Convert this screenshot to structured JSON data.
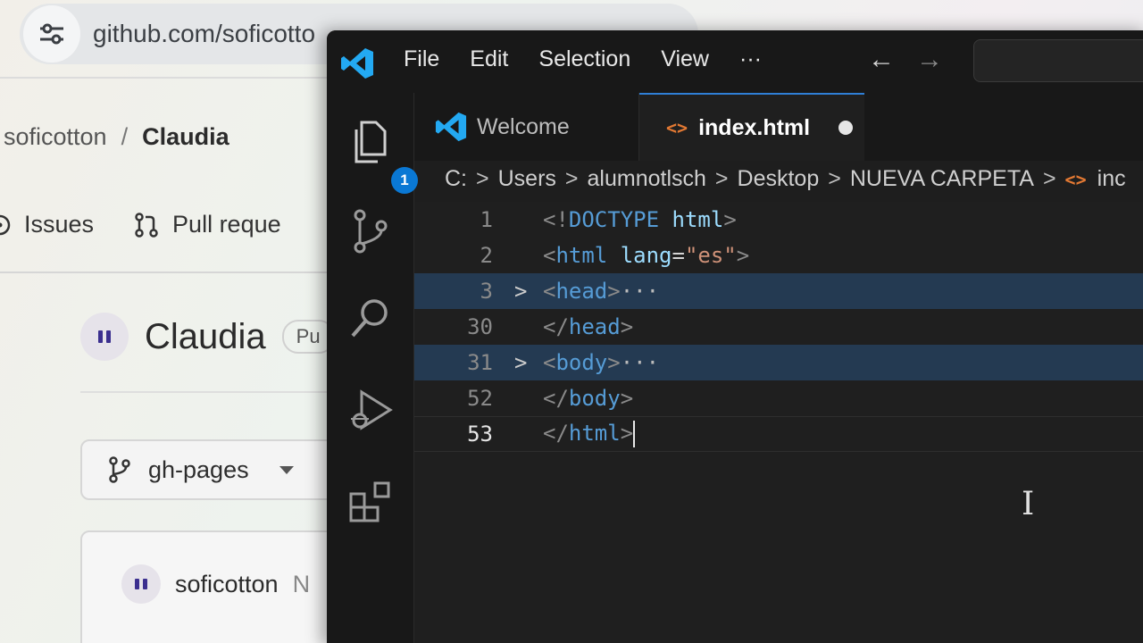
{
  "browser": {
    "url": "github.com/soficotton/Claudia/tree/gh-pages",
    "url_visible": "github.com/soficotto",
    "breadcrumb": {
      "owner": "soficotton",
      "separator": "/",
      "repo": "Claudia"
    },
    "tabs": [
      {
        "label": "Issues",
        "icon": "issues-icon"
      },
      {
        "label": "Pull reque",
        "icon": "pull-request-icon"
      }
    ],
    "repo": {
      "name": "Claudia",
      "visibility_badge": "Pu"
    },
    "branch": {
      "label": "gh-pages",
      "icon": "branch-icon"
    },
    "commit": {
      "author": "soficotton",
      "trailing": "N"
    }
  },
  "vscode": {
    "menu": [
      "File",
      "Edit",
      "Selection",
      "View",
      "···"
    ],
    "nav": {
      "back": "←",
      "forward": "→"
    },
    "source_control_badge": "1",
    "tabs": [
      {
        "label": "Welcome",
        "icon": "vscode-icon",
        "active": false
      },
      {
        "label": "index.html",
        "icon": "html-icon",
        "active": true,
        "dirty": true
      }
    ],
    "breadcrumbs": [
      "C:",
      "Users",
      "alumnotlsch",
      "Desktop",
      "NUEVA CARPETA",
      "inc"
    ],
    "editor_lines": [
      {
        "n": "1",
        "folded": false,
        "text": "<!DOCTYPE html>"
      },
      {
        "n": "2",
        "folded": false,
        "text": "<html lang=\"es\">"
      },
      {
        "n": "3",
        "folded": true,
        "text": "<head>···"
      },
      {
        "n": "30",
        "folded": false,
        "text": "</head>"
      },
      {
        "n": "31",
        "folded": true,
        "text": "<body>···"
      },
      {
        "n": "52",
        "folded": false,
        "text": "</body>"
      },
      {
        "n": "53",
        "folded": false,
        "text": "</html>",
        "current": true
      }
    ],
    "code": {
      "l1": {
        "open": "<!",
        "tag": "DOCTYPE",
        "sp": " ",
        "attr": "html",
        "close": ">"
      },
      "l2": {
        "open": "<",
        "tag": "html",
        "sp": " ",
        "attr": "lang",
        "eq": "=",
        "str": "\"es\"",
        "close": ">"
      },
      "l3": {
        "open": "<",
        "tag": "head",
        "close": ">",
        "ellipsis": "···"
      },
      "l30": {
        "open": "</",
        "tag": "head",
        "close": ">"
      },
      "l31": {
        "open": "<",
        "tag": "body",
        "close": ">",
        "ellipsis": "···"
      },
      "l52": {
        "open": "</",
        "tag": "body",
        "close": ">"
      },
      "l53": {
        "open": "</",
        "tag": "html",
        "close": ">"
      }
    },
    "chevron": ">",
    "colors": {
      "accent": "#0a78d4",
      "tag": "#569cd6",
      "attr": "#9cdcfe",
      "string": "#ce9178",
      "html_icon": "#e37933"
    }
  }
}
